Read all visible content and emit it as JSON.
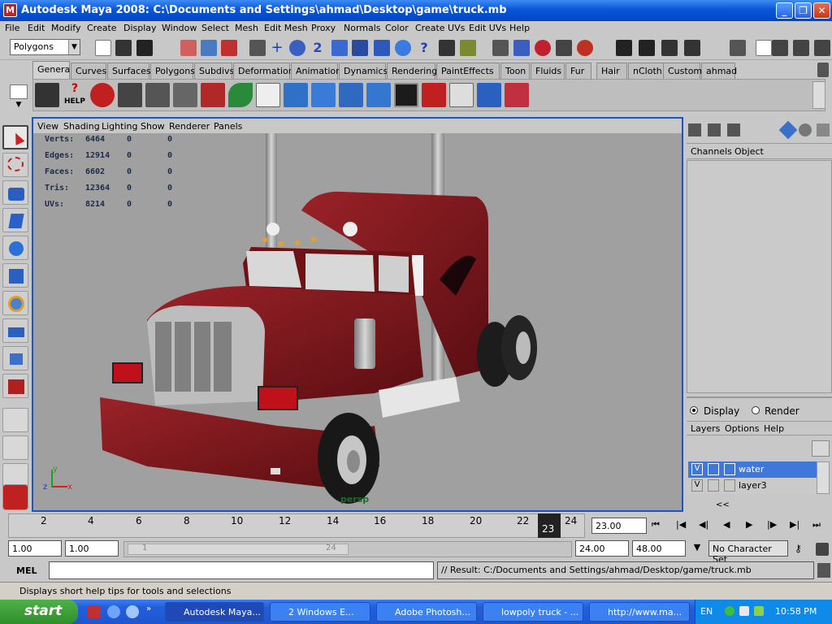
{
  "window": {
    "title": "Autodesk Maya 2008: C:\\Documents and Settings\\ahmad\\Desktop\\game\\truck.mb"
  },
  "menus": [
    "File",
    "Edit",
    "Modify",
    "Create",
    "Display",
    "Window",
    "Select",
    "Mesh",
    "Edit Mesh",
    "Proxy",
    "Normals",
    "Color",
    "Create UVs",
    "Edit UVs",
    "Help"
  ],
  "toolbar": {
    "mode_selector": "Polygons"
  },
  "shelf_tabs": [
    "General",
    "Curves",
    "Surfaces",
    "Polygons",
    "Subdivs",
    "Deformation",
    "Animation",
    "Dynamics",
    "Rendering",
    "PaintEffects",
    "Toon",
    "Fluids",
    "Fur",
    "Hair",
    "nCloth",
    "Custom",
    "ahmad"
  ],
  "shelf": {
    "help_label": "HELP"
  },
  "viewport": {
    "menu": [
      "View",
      "Shading",
      "Lighting",
      "Show",
      "Renderer",
      "Panels"
    ],
    "camera_label": "persp",
    "stats": [
      {
        "label": "Verts:",
        "value": "6464",
        "a": "0",
        "b": "0"
      },
      {
        "label": "Edges:",
        "value": "12914",
        "a": "0",
        "b": "0"
      },
      {
        "label": "Faces:",
        "value": "6602",
        "a": "0",
        "b": "0"
      },
      {
        "label": "Tris:",
        "value": "12364",
        "a": "0",
        "b": "0"
      },
      {
        "label": "UVs:",
        "value": "8214",
        "a": "0",
        "b": "0"
      }
    ],
    "axis": {
      "y": "y",
      "z": "z",
      "x": "x"
    }
  },
  "channel_box": {
    "tabs": [
      "Channels",
      "Object"
    ]
  },
  "layer_editor": {
    "radio_display": "Display",
    "radio_render": "Render",
    "menu": [
      "Layers",
      "Options",
      "Help"
    ],
    "collapse_label": "<<",
    "layers": [
      {
        "visible": "V",
        "name": "water",
        "selected": true
      },
      {
        "visible": "V",
        "name": "layer3",
        "selected": false
      }
    ]
  },
  "timeline": {
    "ticks": [
      "2",
      "4",
      "6",
      "8",
      "10",
      "12",
      "14",
      "16",
      "18",
      "20",
      "22",
      "24"
    ],
    "current_frame": "23",
    "current_time_field": "23.00"
  },
  "range": {
    "start": "1.00",
    "playback_start": "1.00",
    "slider_start": "1",
    "slider_end": "24",
    "playback_end": "24.00",
    "end": "48.00",
    "character_set": "No Character Set"
  },
  "command_line": {
    "label": "MEL",
    "result": "// Result: C:/Documents and Settings/ahmad/Desktop/game/truck.mb"
  },
  "help_line": "Displays short help tips for tools and selections",
  "taskbar": {
    "start_label": "start",
    "items": [
      {
        "label": "Autodesk Maya...",
        "active": true
      },
      {
        "label": "2 Windows E...",
        "active": false
      },
      {
        "label": "Adobe Photosh...",
        "active": false
      },
      {
        "label": "lowpoly truck - ...",
        "active": false
      },
      {
        "label": "http://www.ma...",
        "active": false
      }
    ],
    "language": "EN",
    "clock": "10:58 PM"
  },
  "colors": {
    "title_blue": "#0a55d8",
    "viewport_border": "#1b56c8",
    "truck_red": "#8e1a20",
    "chrome_gray": "#b8b8b8",
    "selected_layer": "#3f78d8",
    "taskbar_blue": "#245edc",
    "start_green": "#2f8f2a"
  }
}
